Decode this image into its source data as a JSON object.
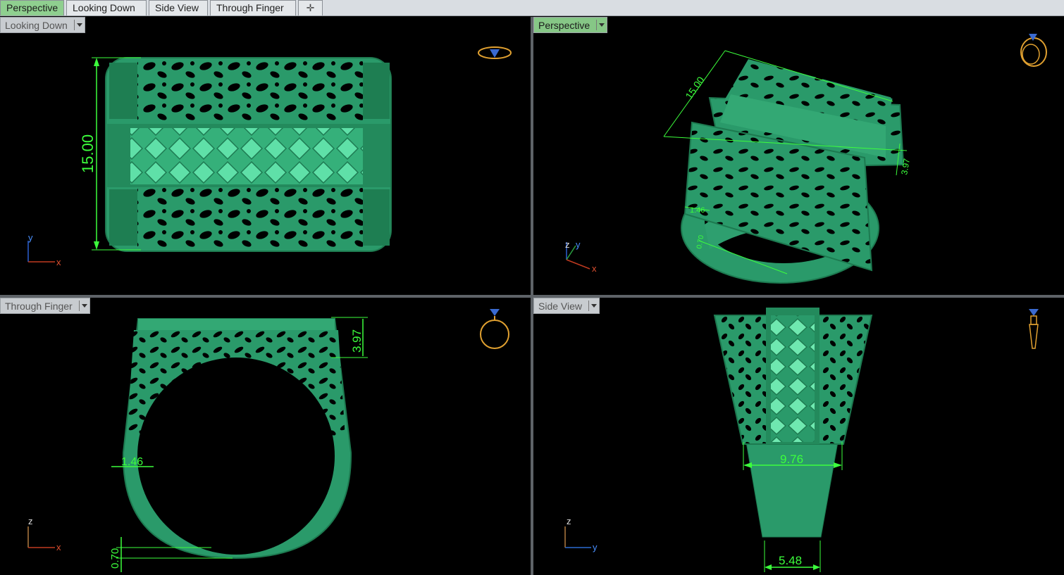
{
  "tabs": [
    {
      "label": "Perspective",
      "active": true
    },
    {
      "label": "Looking Down",
      "active": false
    },
    {
      "label": "Side View",
      "active": false
    },
    {
      "label": "Through Finger",
      "active": false
    }
  ],
  "add_tab_icon": "plus-icon",
  "viewports": {
    "top_left": {
      "label": "Looking Down",
      "axes": [
        "y",
        "x"
      ],
      "dims": {
        "height": "15.00"
      }
    },
    "top_right": {
      "label": "Perspective",
      "axes": [
        "z",
        "y",
        "x"
      ],
      "dims": {
        "length": "15.00",
        "depth": "3.97",
        "band": "1.46",
        "bottom": "0.70"
      }
    },
    "bottom_left": {
      "label": "Through Finger",
      "axes": [
        "z",
        "x"
      ],
      "dims": {
        "depth": "3.97",
        "band": "1.46",
        "bottom": "0.70"
      }
    },
    "bottom_right": {
      "label": "Side View",
      "axes": [
        "z",
        "y"
      ],
      "dims": {
        "width": "9.76",
        "shank": "5.48"
      }
    }
  },
  "colors": {
    "model": "#2a9a6a",
    "dimension": "#3cff3c",
    "gizmo": "#e0a030",
    "active_tab": "#8fcf8f"
  }
}
